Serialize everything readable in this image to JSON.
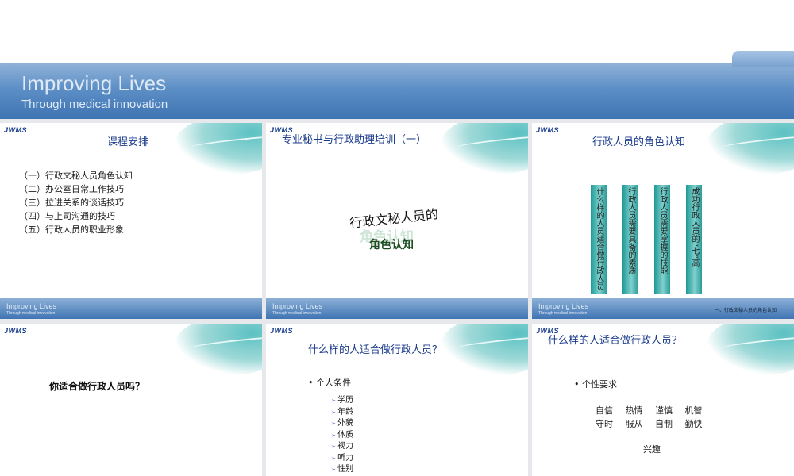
{
  "banner": {
    "title": "Improving Lives",
    "subtitle": "Through medical innovation"
  },
  "logo": "JWMS",
  "footer": {
    "title": "Improving Lives",
    "subtitle": "Through medical innovation",
    "section_label": "一、行政文秘人员的角色认知"
  },
  "slides": [
    {
      "title": "课程安排",
      "items": [
        "（一）行政文秘人员角色认知",
        "（二）办公室日常工作技巧",
        "（三）拉进关系的谈话技巧",
        "（四）与上司沟通的技巧",
        "（五）行政人员的职业形象"
      ]
    },
    {
      "title": "专业秘书与行政助理培训（一）",
      "line1": "行政文秘人员的",
      "ghost": "角色认知",
      "line2": "角色认知"
    },
    {
      "title": "行政人员的角色认知",
      "bars": [
        "什么样的人员适合做行政人员",
        "行政人员需要具备的素质",
        "行政人员需要掌握的技能",
        "成功行政人员的“七”高"
      ]
    },
    {
      "question": "你适合做行政人员吗？"
    },
    {
      "title": "什么样的人适合做行政人员？",
      "bullet": "个人条件",
      "items": [
        "学历",
        "年龄",
        "外貌",
        "体质",
        "视力",
        "听力",
        "性别"
      ]
    },
    {
      "title": "什么样的人适合做行政人员？",
      "bullet": "个性要求",
      "row1": "自信 热情 谨慎 机智",
      "row2": "守时 服从 自制 勤快",
      "extra": "兴趣"
    }
  ]
}
